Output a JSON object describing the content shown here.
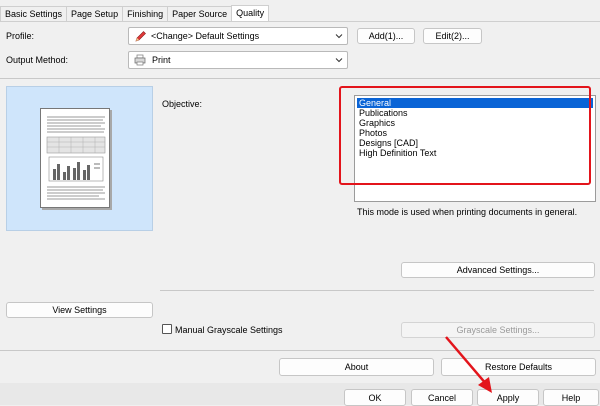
{
  "tabs": [
    "Basic Settings",
    "Page Setup",
    "Finishing",
    "Paper Source",
    "Quality"
  ],
  "active_tab": 4,
  "profile": {
    "label": "Profile:",
    "value": "<Change> Default Settings",
    "add_button": "Add(1)...",
    "edit_button": "Edit(2)..."
  },
  "output": {
    "label": "Output Method:",
    "value": "Print"
  },
  "objective": {
    "label": "Objective:",
    "items": [
      "General",
      "Publications",
      "Graphics",
      "Photos",
      "Designs [CAD]",
      "High Definition Text"
    ],
    "selected_index": 0,
    "description": "This mode is used when printing documents in general."
  },
  "buttons": {
    "advanced": "Advanced Settings...",
    "view": "View Settings",
    "grayscale": "Grayscale Settings...",
    "about": "About",
    "restore": "Restore Defaults",
    "ok": "OK",
    "cancel": "Cancel",
    "apply": "Apply",
    "help": "Help"
  },
  "grayscale_checkbox": {
    "label": "Manual Grayscale Settings",
    "checked": false
  },
  "colors": {
    "accent": "#0a64d6",
    "highlight": "#e3141b",
    "preview_bg": "#cfe5fb"
  }
}
